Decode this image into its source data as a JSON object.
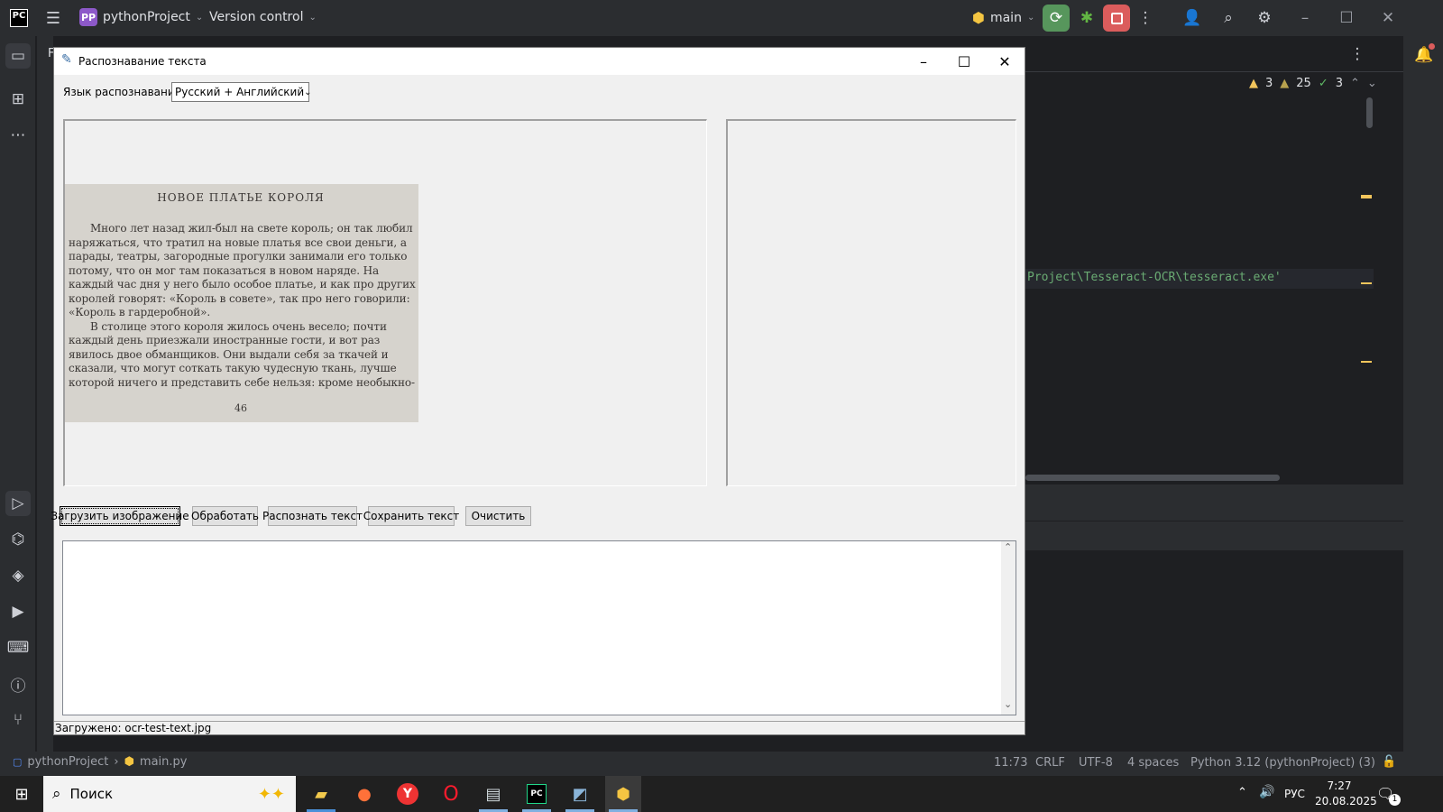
{
  "ide": {
    "logo": "PC",
    "project_badge": "PP",
    "project_name": "pythonProject",
    "vcs_label": "Version control",
    "branch": "main",
    "inspections": {
      "warnings_a": "3",
      "warnings_b": "25",
      "ok": "3"
    },
    "code_snippet": "Project\\Tesseract-OCR\\tesseract.exe'",
    "panel_letter": "F"
  },
  "dialog": {
    "title": "Распознавание текста",
    "language_label": "Язык распознавания:",
    "language_value": "Русский + Английский",
    "buttons": {
      "load": "Загрузить изображение",
      "process": "Обработать",
      "recognize": "Распознать текст",
      "save": "Сохранить текст",
      "clear": "Очистить"
    },
    "status": "Загружено: ocr-test-text.jpg",
    "scan": {
      "heading": "НОВОЕ ПЛАТЬЕ КОРОЛЯ",
      "lines": [
        "Много лет назад жил-был на свете король; он так любил",
        "наряжаться, что тратил на новые платья все свои деньги, а",
        "парады, театры, загородные прогулки занимали его только",
        "потому, что он мог там показаться в новом наряде. На",
        "каждый час дня у него было особое платье, и как про других",
        "королей говорят: «Король в совете», так про него говорили:",
        "«Король в гардеробной».",
        "В столице этого короля жилось очень весело; почти",
        "каждый день приезжали иностранные гости, и вот раз",
        "явилось двое обманщиков. Они выдали себя за ткачей и",
        "сказали, что могут соткать такую чудесную ткань, лучше",
        "которой ничего и представить себе нельзя: кроме необыкно-"
      ],
      "page_number": "46"
    }
  },
  "statusbar": {
    "breadcrumb_project": "pythonProject",
    "breadcrumb_file": "main.py",
    "position": "11:73",
    "line_sep": "CRLF",
    "encoding": "UTF-8",
    "indent": "4 spaces",
    "interpreter": "Python 3.12 (pythonProject) (3)"
  },
  "taskbar": {
    "search_placeholder": "Поиск",
    "lang": "РУС",
    "time": "7:27",
    "date": "20.08.2025",
    "notif_count": "1"
  },
  "colors": {
    "ide_bg": "#1e1f22",
    "ide_bar": "#2b2d30",
    "run_green": "#57965c",
    "stop_red": "#db5c5c",
    "dialog_bg": "#f0f0f0"
  }
}
